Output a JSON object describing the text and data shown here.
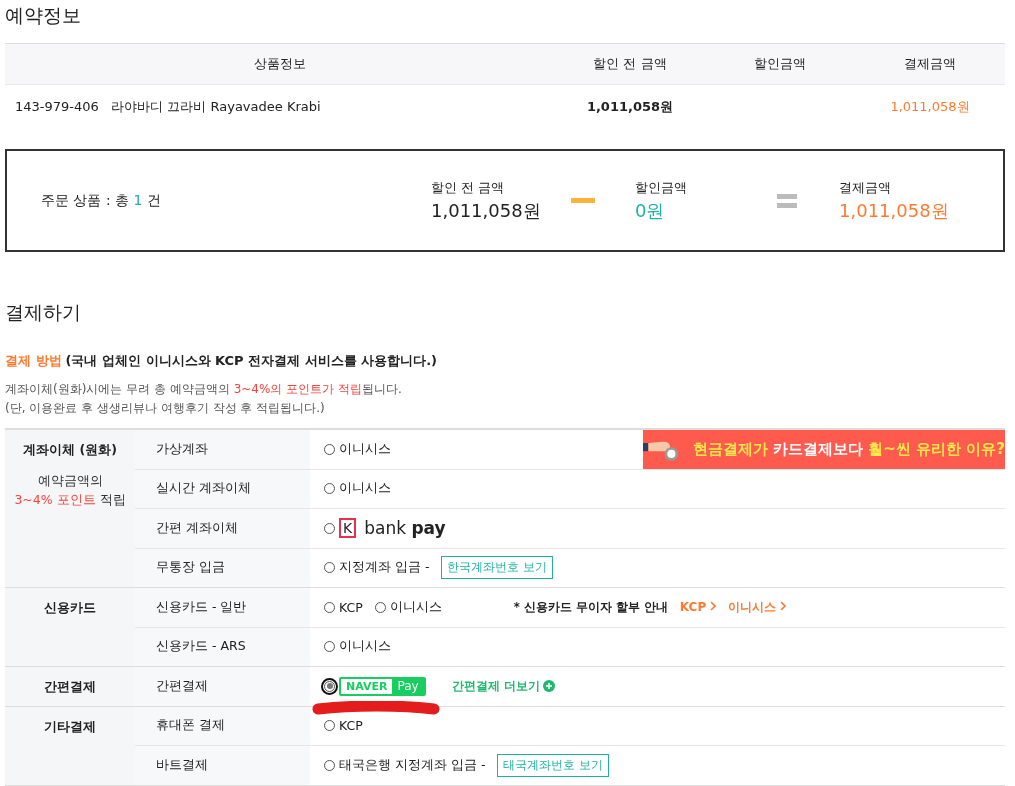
{
  "reservation": {
    "title": "예약정보",
    "columns": [
      "상품정보",
      "할인 전 금액",
      "할인금액",
      "결제금액"
    ],
    "rows": [
      {
        "code": "143-979-406",
        "name": "라야바디 끄라비 Rayavadee Krabi",
        "original": "1,011,058원",
        "discount": "",
        "total": "1,011,058원"
      }
    ]
  },
  "summary": {
    "count_parts": [
      {
        "text": "주문 상품 : 총 ",
        "kind": "plain"
      },
      {
        "text": "1",
        "kind": "teal"
      },
      {
        "text": " 건",
        "kind": "plain"
      }
    ],
    "items": [
      {
        "label": "할인 전 금액",
        "value": "1,011,058원",
        "kind": "plain"
      },
      {
        "label": "할인금액",
        "value": "0원",
        "kind": "teal"
      },
      {
        "label": "결제금액",
        "value": "1,011,058원",
        "kind": "orange"
      }
    ]
  },
  "payment": {
    "title": "결제하기",
    "method_title": "결제 방법",
    "method_note": "(국내 업체인 이니시스와 KCP 전자결제 서비스를 사용합니다.)",
    "notes": [
      [
        {
          "text": "계좌이체(원화)시에는 무려 총 예약금액의 ",
          "kind": "plain"
        },
        {
          "text": "3~4%의 포인트가 적립",
          "kind": "red"
        },
        {
          "text": "됩니다.",
          "kind": "plain"
        }
      ],
      [
        {
          "text": "(단, 이용완료 후 생생리뷰나 여행후기 작성 후 적립됩니다.)",
          "kind": "plain"
        }
      ]
    ],
    "groups": [
      {
        "name": "계좌이체 (원화)",
        "extra": [
          {
            "text": "예약금액의",
            "kind": "plain"
          },
          {
            "text": "3~4% 포인트",
            "kind": "red",
            "after": " 적립"
          }
        ],
        "rows": [
          {
            "method": "가상계좌",
            "items": [
              {
                "kind": "radio",
                "label": "이니시스",
                "selected": false
              },
              {
                "kind": "banner",
                "parts": [
                  {
                    "text": "현금결제가",
                    "kind": "yellow"
                  },
                  {
                    "text": " 카드결제보다 ",
                    "kind": "plain"
                  },
                  {
                    "text": "훨~씬 유리한 이유?",
                    "kind": "yellow"
                  }
                ]
              }
            ]
          },
          {
            "method": "실시간 계좌이체",
            "items": [
              {
                "kind": "radio",
                "label": "이니시스",
                "selected": false
              }
            ]
          },
          {
            "method": "간편 계좌이체",
            "items": [
              {
                "kind": "kbank",
                "mark": "K",
                "label": "bank",
                "strong": "pay",
                "selected": false
              }
            ]
          },
          {
            "method": "무통장 입금",
            "items": [
              {
                "kind": "radio",
                "label": "지정계좌 입금 -",
                "selected": false
              },
              {
                "kind": "button",
                "label": "한국계좌번호 보기"
              }
            ]
          }
        ]
      },
      {
        "name": "신용카드",
        "rows": [
          {
            "method": "신용카드 - 일반",
            "items": [
              {
                "kind": "radio",
                "label": "KCP",
                "selected": false
              },
              {
                "kind": "radio",
                "label": "이니시스",
                "selected": false
              },
              {
                "kind": "note",
                "label": "* 신용카드 무이자 할부 안내"
              },
              {
                "kind": "link",
                "label": "KCP"
              },
              {
                "kind": "link",
                "label": "이니시스"
              }
            ]
          },
          {
            "method": "신용카드 - ARS",
            "items": [
              {
                "kind": "radio",
                "label": "이니시스",
                "selected": false
              }
            ]
          }
        ]
      },
      {
        "name": "간편결제",
        "rows": [
          {
            "method": "간편결제",
            "items": [
              {
                "kind": "naver",
                "label": "NAVER",
                "strong": "Pay",
                "selected": true,
                "scribbled": true
              },
              {
                "kind": "more",
                "label": "간편결제 더보기"
              }
            ]
          }
        ]
      },
      {
        "name": "기타결제",
        "rows": [
          {
            "method": "휴대폰 결제",
            "items": [
              {
                "kind": "radio",
                "label": "KCP",
                "selected": false
              }
            ]
          },
          {
            "method": "바트결제",
            "items": [
              {
                "kind": "radio",
                "label": "태국은행 지정계좌 입금 -",
                "selected": false
              },
              {
                "kind": "button",
                "label": "태국계좌번호 보기"
              }
            ]
          }
        ]
      }
    ]
  }
}
